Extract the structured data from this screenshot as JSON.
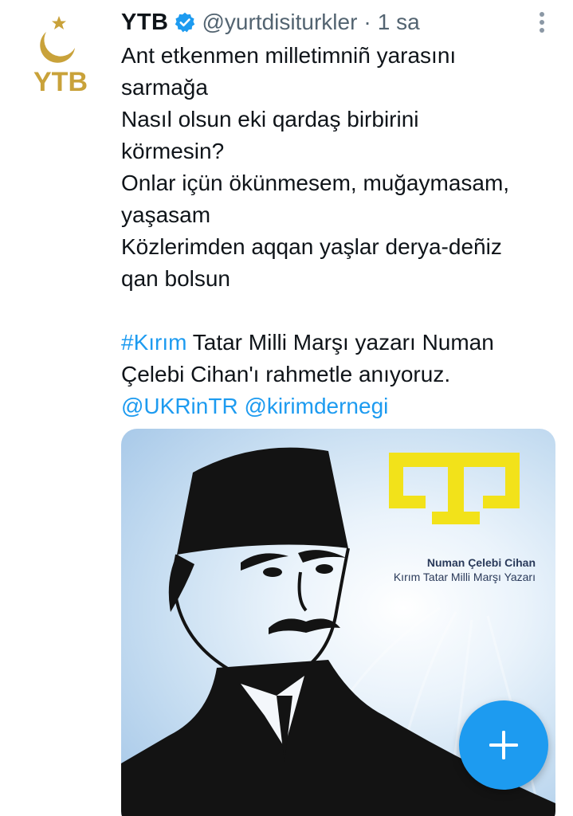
{
  "tweet": {
    "author_name": "YTB",
    "handle": "@yurtdisiturkler",
    "separator": "·",
    "time": "1 sa",
    "logo_text": "YTB",
    "body_lines": [
      "Ant etkenmen milletimniñ yarasını",
      "sarmağa",
      "Nasıl olsun eki qardaş birbirini",
      "körmesin?",
      "Onlar içün ökünmesem, muğaymasam,",
      "yaşasam",
      "Közlerimden aqqan yaşlar derya-deñiz",
      "qan bolsun"
    ],
    "hashtag": "#Kırım",
    "text_after_hashtag": " Tatar Milli Marşı yazarı Numan",
    "text_line_2": "Çelebi Cihan'ı rahmetle anıyoruz.",
    "mention_1": "@UKRinTR",
    "mention_2": "@kirimdernegi"
  },
  "media": {
    "caption_name": "Numan Çelebi Cihan",
    "caption_sub": "Kırım Tatar Milli Marşı Yazarı"
  },
  "icons": {
    "verified": "verified-badge-icon",
    "more": "more-options-icon",
    "compose": "plus-icon"
  },
  "colors": {
    "link": "#1d9bf0",
    "logo_gold": "#c9a23a",
    "tamga_yellow": "#f2e21a",
    "fab": "#1d9bf0"
  }
}
